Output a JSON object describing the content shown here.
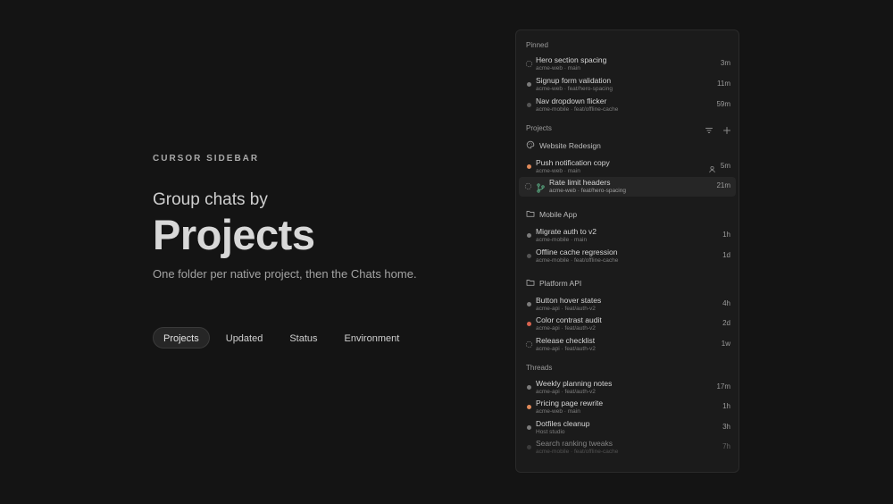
{
  "hero": {
    "eyebrow": "CURSOR SIDEBAR",
    "lead": "Group chats by",
    "title": "Projects",
    "subtitle": "One folder per native project, then the Chats home.",
    "pills": [
      "Projects",
      "Updated",
      "Status",
      "Environment"
    ],
    "active_pill": "Projects"
  },
  "sidebar": {
    "pinned_label": "Pinned",
    "pinned": [
      {
        "title": "Hero section spacing",
        "meta": "acme-web · main",
        "time": "3m",
        "icon": "sparkle-icon"
      },
      {
        "title": "Signup form validation",
        "meta": "acme-web · feat/hero-spacing",
        "time": "11m",
        "icon": "dot"
      },
      {
        "title": "Nav dropdown flicker",
        "meta": "acme-mobile · feat/offline-cache",
        "time": "59m",
        "icon": "dot-dim"
      }
    ],
    "projects_label": "Projects",
    "projects": [
      {
        "name": "Website Redesign",
        "icon": "palette-icon",
        "chats": [
          {
            "title": "Push notification copy",
            "meta": "acme-web · main",
            "time": "5m",
            "icon": "dot-orange"
          },
          {
            "title": "Rate limit headers",
            "meta": "acme-web · feat/hero-spacing",
            "time": "21m",
            "icon": "sparkle-icon"
          }
        ]
      },
      {
        "name": "Mobile App",
        "icon": "folder-icon",
        "chats": [
          {
            "title": "Migrate auth to v2",
            "meta": "acme-mobile · main",
            "time": "1h",
            "icon": "dot"
          },
          {
            "title": "Offline cache regression",
            "meta": "acme-mobile · feat/offline-cache",
            "time": "1d",
            "icon": "dot-dim"
          }
        ]
      },
      {
        "name": "Platform API",
        "icon": "folder-icon",
        "chats": [
          {
            "title": "Button hover states",
            "meta": "acme-api · feat/auth-v2",
            "time": "4h",
            "icon": "dot"
          },
          {
            "title": "Color contrast audit",
            "meta": "acme-api · feat/auth-v2",
            "time": "2d",
            "icon": "dot-red"
          },
          {
            "title": "Release checklist",
            "meta": "acme-api · feat/auth-v2",
            "time": "1w",
            "icon": "sparkle-icon"
          }
        ]
      }
    ],
    "threads_label": "Threads",
    "threads": [
      {
        "title": "Weekly planning notes",
        "meta": "acme-api · feat/auth-v2",
        "time": "17m",
        "icon": "dot"
      },
      {
        "title": "Pricing page rewrite",
        "meta": "acme-web · main",
        "time": "1h",
        "icon": "dot-orange"
      },
      {
        "title": "Dotfiles cleanup",
        "meta": "Host studio",
        "time": "3h",
        "icon": "dot"
      },
      {
        "title": "Search ranking tweaks",
        "meta": "acme-mobile · feat/offline-cache",
        "time": "7h",
        "icon": "dot-dim"
      }
    ]
  },
  "colors": {
    "background": "#141414",
    "panel": "#1b1b1b",
    "accent_orange": "#e08a5a",
    "accent_red": "#d9634f"
  }
}
